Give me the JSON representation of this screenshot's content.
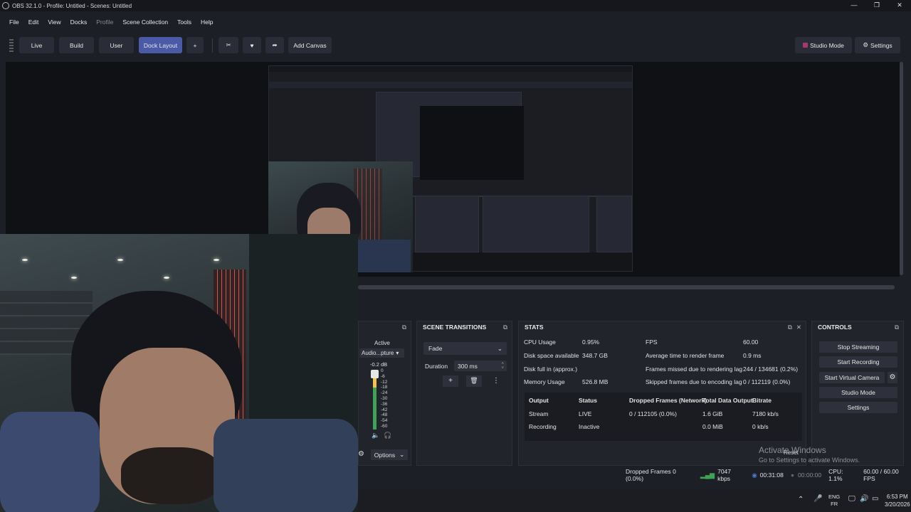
{
  "window": {
    "title": "OBS 32.1.0 - Profile: Untitled - Scenes: Untitled",
    "controls": [
      "minimize-icon",
      "restore-icon",
      "close-icon"
    ]
  },
  "menu": [
    "File",
    "Edit",
    "View",
    "Docks",
    "Profile",
    "Scene Collection",
    "Tools",
    "Help"
  ],
  "toolbar": {
    "tabs": [
      "Live",
      "Build",
      "User",
      "Dock Layout"
    ],
    "active_tab": "Dock Layout",
    "add_label": "+",
    "add_canvas": "Add Canvas",
    "studio_mode": "Studio Mode",
    "settings": "Settings",
    "icons": [
      "tools-icon",
      "heart-icon",
      "share-icon"
    ]
  },
  "audio_mixer": {
    "active_label": "Active",
    "device": "Audio...pture",
    "db_value": "-0.2 dB",
    "scale": [
      "0",
      "-6",
      "-12",
      "-18",
      "-24",
      "-30",
      "-36",
      "-42",
      "-48",
      "-54",
      "-60"
    ],
    "options_label": "Options"
  },
  "scene_transitions": {
    "title": "SCENE TRANSITIONS",
    "transition": "Fade",
    "duration_label": "Duration",
    "duration_value": "300 ms"
  },
  "stats": {
    "title": "STATS",
    "left": [
      {
        "label": "CPU Usage",
        "value": "0.95%"
      },
      {
        "label": "Disk space available",
        "value": "348.7 GB"
      },
      {
        "label": "Disk full in (approx.)",
        "value": ""
      },
      {
        "label": "Memory Usage",
        "value": "526.8 MB"
      }
    ],
    "right": [
      {
        "label": "FPS",
        "value": "60.00"
      },
      {
        "label": "Average time to render frame",
        "value": "0.9 ms"
      },
      {
        "label": "Frames missed due to rendering lag",
        "value": "244 / 134681 (0.2%)"
      },
      {
        "label": "Skipped frames due to encoding lag",
        "value": "0 / 112119 (0.0%)"
      }
    ],
    "table_headers": [
      "Output",
      "Status",
      "Dropped Frames (Network)",
      "Total Data Output",
      "Bitrate"
    ],
    "rows": [
      [
        "Stream",
        "LIVE",
        "0 / 112105 (0.0%)",
        "1.6 GiB",
        "7180 kb/s"
      ],
      [
        "Recording",
        "Inactive",
        "",
        "0.0 MiB",
        "0 kb/s"
      ]
    ],
    "reset_label": "Reset"
  },
  "controls": {
    "title": "CONTROLS",
    "buttons": [
      "Stop Streaming",
      "Start Recording",
      "Start Virtual Camera",
      "Studio Mode",
      "Settings"
    ]
  },
  "statusbar": {
    "dropped": "Dropped Frames 0 (0.0%)",
    "kbps": "7047 kbps",
    "stream_time": "00:31:08",
    "rec_time": "00:00:00",
    "cpu": "CPU: 1.1%",
    "fps": "60.00 / 60.00 FPS"
  },
  "activate_windows": {
    "title": "Activate Windows",
    "subtitle": "Go to Settings to activate Windows."
  },
  "taskbar": {
    "lang_top": "ENG",
    "lang_bottom": "FR",
    "time": "6:53 PM",
    "date": "3/20/2026"
  },
  "colors": {
    "accent": "#4a5aa6",
    "background": "#1d1f26",
    "signal_green": "#3fa356"
  }
}
